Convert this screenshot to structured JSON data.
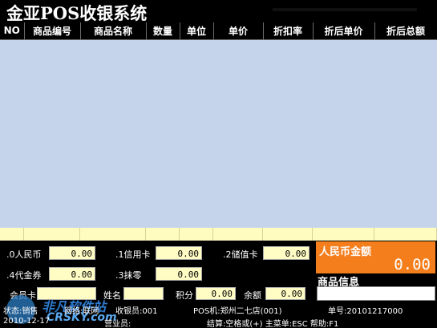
{
  "app": {
    "title": "金亚POS收银系统"
  },
  "grid": {
    "columns": [
      "NO",
      "商品编号",
      "商品名称",
      "数量",
      "单位",
      "单价",
      "折扣率",
      "折后单价",
      "折后总额"
    ]
  },
  "payments": [
    {
      "label": ".0人民币",
      "value": "0.00"
    },
    {
      "label": ".1信用卡",
      "value": "0.00"
    },
    {
      "label": ".2储值卡",
      "value": "0.00"
    },
    {
      "label": ".4代金券",
      "value": "0.00"
    },
    {
      "label": ".3抹零",
      "value": "0.00"
    }
  ],
  "member": {
    "card_label": "会员卡",
    "name_label": "姓名",
    "points_label": "积分",
    "points_value": "0.00",
    "balance_label": "余额",
    "balance_value": "0.00"
  },
  "total": {
    "label": "人民币金额",
    "value": "0.00"
  },
  "product_info": {
    "label": "商品信息"
  },
  "status": {
    "state": "状态:销售",
    "network": "网络:联网",
    "cashier": "收银员:001",
    "pos": "POS机:郑州二七店(001)",
    "order_no": "单号:20101217000",
    "date": "2010-12-17",
    "salesperson": "营业员:",
    "shortcuts": "结算:空格或(+) 主菜单:ESC 帮助:F1"
  },
  "watermark": {
    "cn": "非凡软件站",
    "en": "CRSKY.com"
  },
  "colors": {
    "grid_bg": "#c6d4eb",
    "total_row": "#fffcc0",
    "input_bg": "#fffdc4",
    "accent_orange": "#f47e1c",
    "logo_blue": "#2c7dc6"
  }
}
